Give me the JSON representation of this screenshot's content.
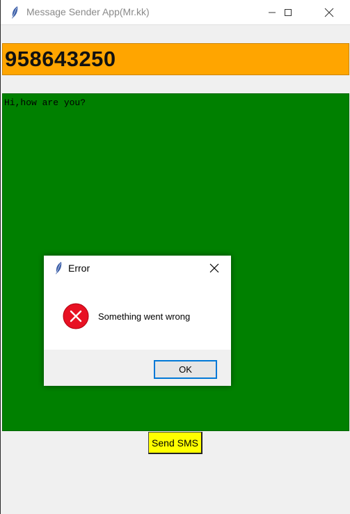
{
  "window": {
    "title": "Message Sender App(Mr.kk)",
    "controls": {
      "minimize": "minimize-icon",
      "maximize": "maximize-icon",
      "close": "close-icon"
    }
  },
  "phone_field": {
    "value": "958643250",
    "background": "#ffa500"
  },
  "message_box": {
    "value": "Hi,how are you?",
    "background": "#008000"
  },
  "send_button": {
    "label": "Send SMS",
    "background": "#ffff00"
  },
  "dialog": {
    "title": "Error",
    "message": "Something went wrong",
    "ok_label": "OK",
    "icon": "error-icon",
    "accent": "#0078d7"
  }
}
